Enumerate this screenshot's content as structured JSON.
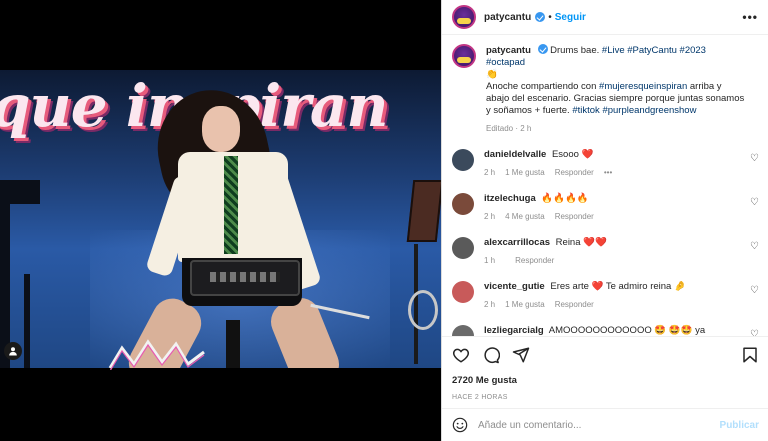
{
  "post": {
    "username": "patycantu",
    "follow_label": "Seguir",
    "separator": "•",
    "more_label": "•••",
    "banner_text": "que inspiran"
  },
  "caption": {
    "username": "patycantu",
    "text_intro": "Drums bae. ",
    "tags_line1": "#Live #PatyCantu #2023 #octapad",
    "emoji_line1": "👏",
    "text_body": "Anoche compartiendo con ",
    "mention": "#mujeresqueinspiran",
    "text_body2": " arriba y abajo del escenario. Gracias siempre porque juntas sonamos y soñamos + fuerte. ",
    "tags_line2": "#tiktok #purpleandgreenshow",
    "edited": "Editado · 2 h"
  },
  "comments": [
    {
      "username": "danieldelvalle",
      "text": "Esooo ❤️",
      "time": "2 h",
      "likes": "1 Me gusta",
      "reply": "Responder",
      "more": "•••",
      "avatar_color": "#3b4a5c"
    },
    {
      "username": "itzelechuga",
      "text": "🔥🔥🔥🔥",
      "time": "2 h",
      "likes": "4 Me gusta",
      "reply": "Responder",
      "more": "",
      "avatar_color": "#7a4a3a"
    },
    {
      "username": "alexcarrillocas",
      "text": "Reina ❤️❤️",
      "time": "1 h",
      "likes": "",
      "reply": "Responder",
      "more": "",
      "avatar_color": "#5a5a5a"
    },
    {
      "username": "vicente_gutie",
      "text": "Eres arte ❤️ Te admiro reina 🤌",
      "time": "2 h",
      "likes": "1 Me gusta",
      "reply": "Responder",
      "more": "",
      "avatar_color": "#c85a5a"
    },
    {
      "username": "lezliegarcialg",
      "text": "AMOOOOOOOOOOOO 🤩 🤩🤩 ya mujerooooooo",
      "time": "",
      "likes": "",
      "reply": "",
      "more": "",
      "avatar_color": "#6a6a6a"
    }
  ],
  "actions": {
    "likes_count": "2720 Me gusta",
    "time_ago": "HACE 2 HORAS"
  },
  "composer": {
    "placeholder": "Añade un comentario...",
    "publish_label": "Publicar"
  },
  "colors": {
    "accent": "#0095f6",
    "verified": "#3897f0",
    "muted": "#8e8e8e",
    "heart_red": "#ed4956"
  },
  "icons": {
    "like": "heart-icon",
    "comment": "comment-icon",
    "share": "share-icon",
    "save": "bookmark-icon",
    "emoji": "emoji-icon",
    "user_tag": "user-tag-icon"
  }
}
